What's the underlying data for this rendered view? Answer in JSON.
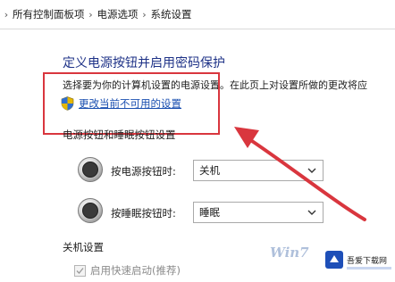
{
  "breadcrumb": {
    "items": [
      "所有控制面板项",
      "电源选项",
      "系统设置"
    ]
  },
  "page": {
    "title": "定义电源按钮并启用密码保护",
    "description": "选择要为你的计算机设置的电源设置。在此页上对设置所做的更改将应",
    "change_link": "更改当前不可用的设置",
    "section_label": "电源按钮和睡眠按钮设置"
  },
  "power_button": {
    "label": "按电源按钮时:",
    "value": "关机"
  },
  "sleep_button": {
    "label": "按睡眠按钮时:",
    "value": "睡眠"
  },
  "shutdown": {
    "title": "关机设置",
    "fast_startup_label": "启用快速启动(推荐)"
  },
  "watermark": {
    "text": "Win7",
    "logo_text": "吾爱下载网"
  },
  "colors": {
    "title_blue": "#1e3287",
    "link_blue": "#1a4fb0",
    "highlight_red": "#d9363e"
  }
}
